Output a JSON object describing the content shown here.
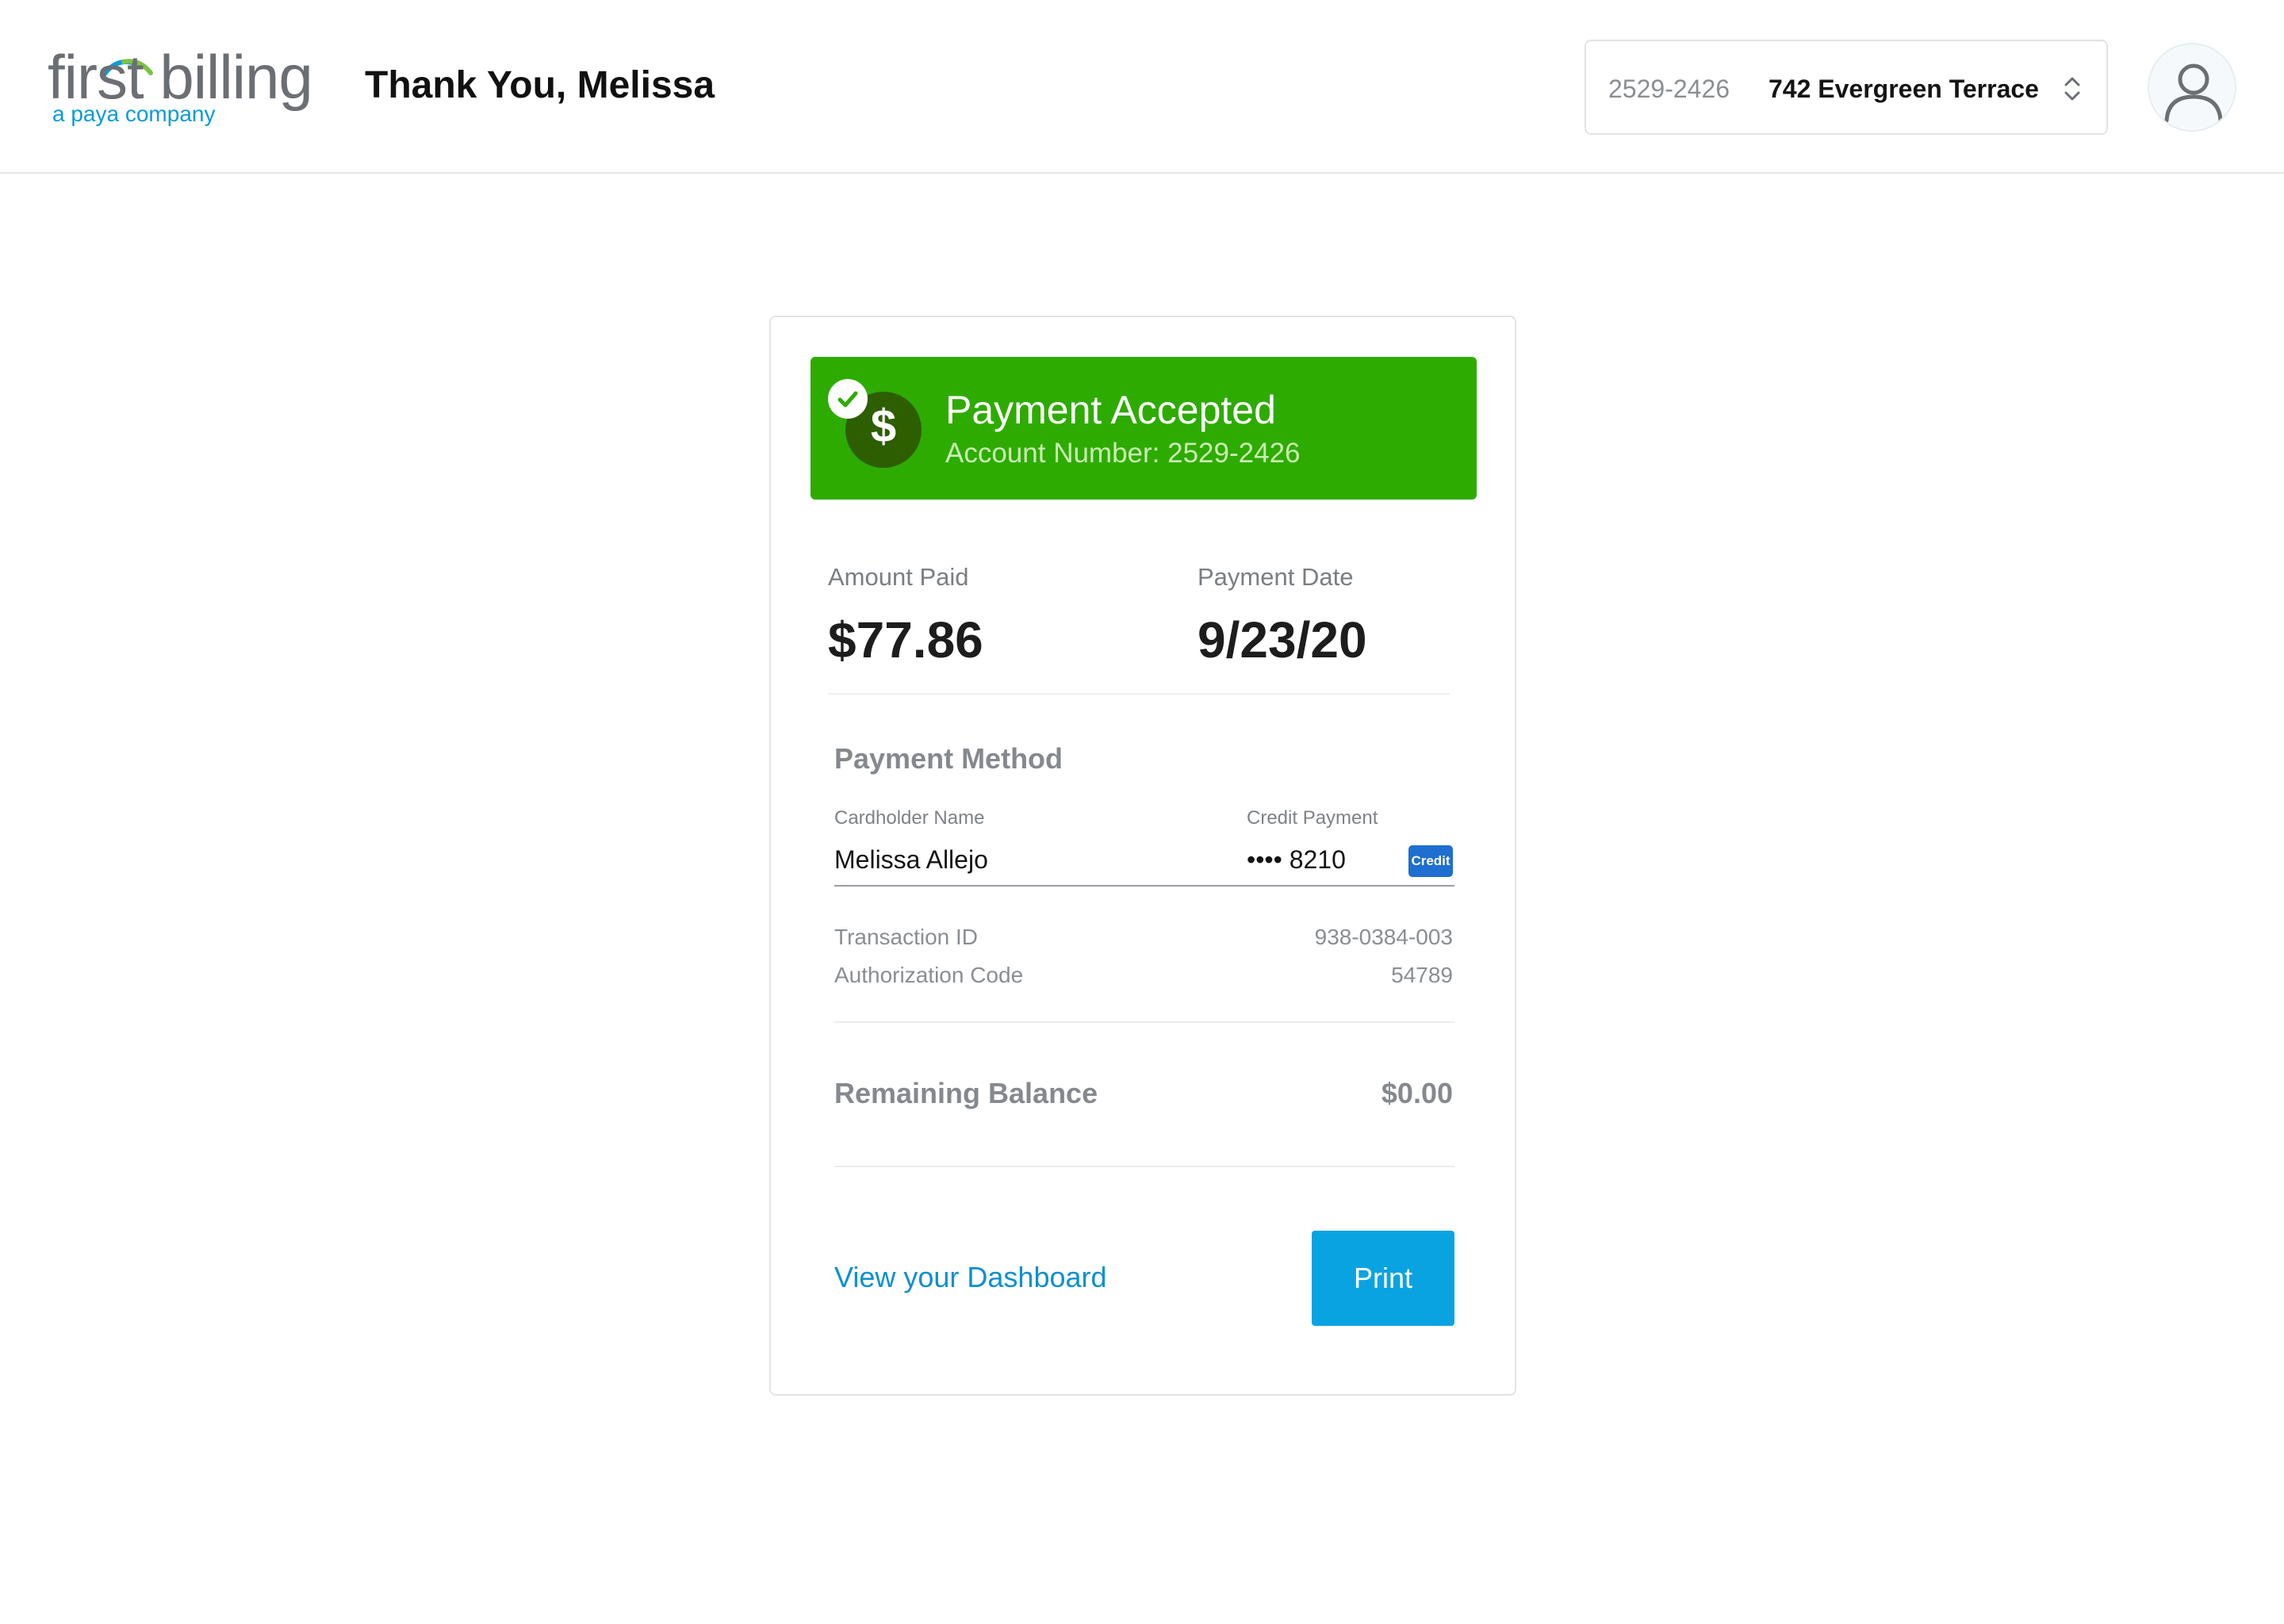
{
  "header": {
    "logo": {
      "brand": "first billing",
      "tagline": "a paya company"
    },
    "title": "Thank You, Melissa",
    "account_selector": {
      "account_number": "2529-2426",
      "address": "742 Evergreen Terrace"
    },
    "avatar_icon": "user-icon"
  },
  "confirmation": {
    "banner": {
      "title": "Payment Accepted",
      "subtitle": "Account Number: 2529-2426",
      "icons": [
        "dollar-icon",
        "check-icon"
      ],
      "color": "#2eab00"
    },
    "amount_paid": {
      "label": "Amount Paid",
      "value": "$77.86"
    },
    "payment_date": {
      "label": "Payment Date",
      "value": "9/23/20"
    },
    "payment_method": {
      "title": "Payment Method",
      "cardholder_label": "Cardholder Name",
      "cardholder_value": "Melissa Allejo",
      "credit_label": "Credit Payment",
      "credit_value": "•••• 8210",
      "card_badge": "Credit"
    },
    "details": [
      {
        "label": "Transaction ID",
        "value": "938-0384-003"
      },
      {
        "label": "Authorization Code",
        "value": "54789"
      }
    ],
    "remaining_balance": {
      "label": "Remaining Balance",
      "value": "$0.00"
    },
    "actions": {
      "dashboard_link": "View your Dashboard",
      "print_label": "Print"
    }
  },
  "colors": {
    "accent": "#0aa3e2",
    "success": "#2eab00",
    "link": "#0a8fd2"
  }
}
